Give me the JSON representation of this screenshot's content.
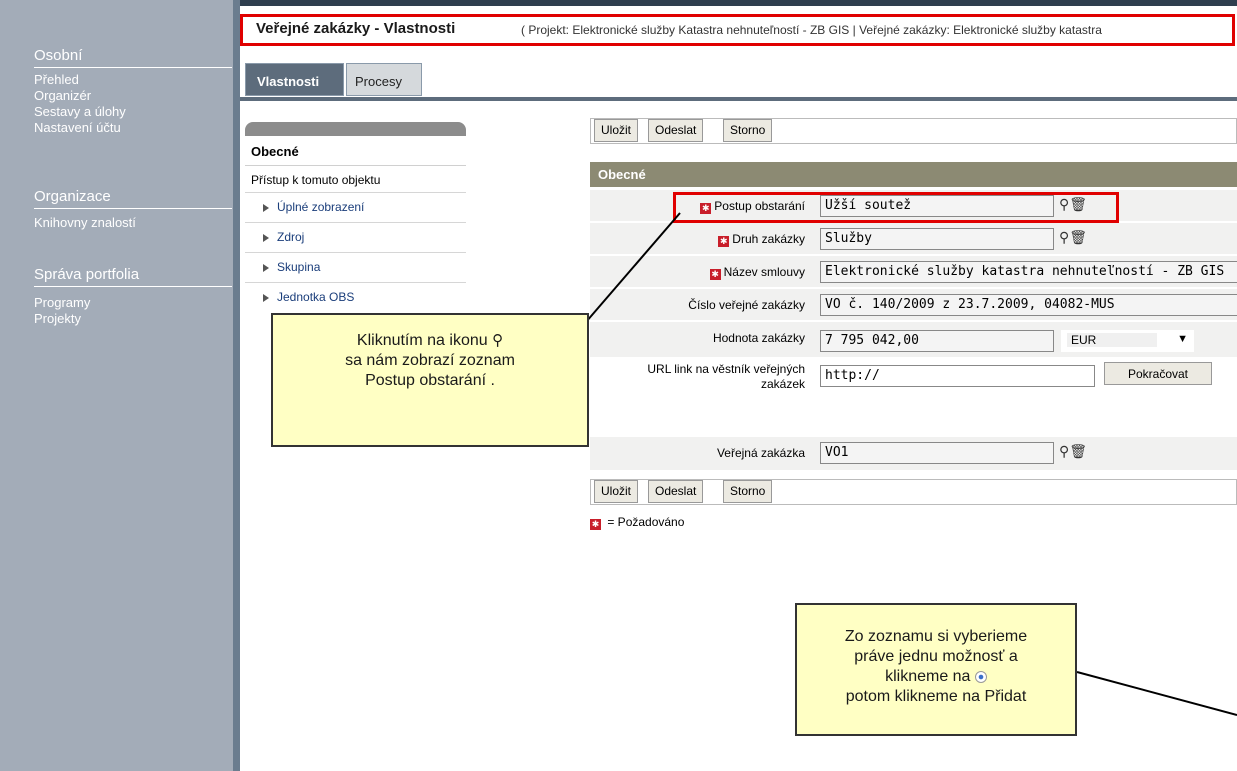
{
  "sidebar": {
    "osobni": {
      "title": "Osobní",
      "items": [
        "Přehled",
        "Organizér",
        "Sestavy a úlohy",
        "Nastavení účtu"
      ]
    },
    "organizace": {
      "title": "Organizace",
      "items": [
        "Knihovny znalostí"
      ]
    },
    "sprava": {
      "title": "Správa portfolia",
      "items": [
        "Programy",
        "Projekty"
      ]
    }
  },
  "header": {
    "title": "Veřejné zakázky - Vlastnosti",
    "subtitle": "( Projekt: Elektronické služby Katastra nehnuteľností - ZB GIS | Veřejné zakázky: Elektronické služby katastra"
  },
  "tabs": [
    "Vlastnosti",
    "Procesy"
  ],
  "nav": {
    "section": "Obecné",
    "access": "Přístup k tomuto objektu",
    "items": [
      "Úplné zobrazení",
      "Zdroj",
      "Skupina",
      "Jednotka OBS"
    ]
  },
  "buttons": {
    "save": "Uložit",
    "send": "Odeslat",
    "cancel": "Storno",
    "continue": "Pokračovat"
  },
  "form": {
    "title": "Obecné",
    "fields": {
      "postup": {
        "label": "Postup obstarání",
        "value": "Užší soutež"
      },
      "druh": {
        "label": "Druh zakázky",
        "value": "Služby"
      },
      "nazev": {
        "label": "Název smlouvy",
        "value": "Elektronické služby katastra nehnuteľností - ZB GIS"
      },
      "cislo": {
        "label": "Číslo veřejné zakázky",
        "value": "VO č. 140/2009 z 23.7.2009, 04082-MUS"
      },
      "hodnota": {
        "label": "Hodnota zakázky",
        "value": "7 795 042,00",
        "currency": "EUR"
      },
      "url": {
        "label": "URL link na věstník veřejných zakázek",
        "value": "http://"
      },
      "vz": {
        "label": "Veřejná zakázka",
        "value": "VO1"
      }
    },
    "required_legend": "= Požadováno"
  },
  "callouts": {
    "first": {
      "line1": "Kliknutím na ikonu",
      "line2": "sa nám zobrazí zoznam",
      "line3": "Postup obstarání ."
    },
    "second": {
      "line1": "Zo zoznamu si vyberieme",
      "line2": "práve jednu možnosť a",
      "line3": "klikneme na",
      "line4": "potom klikneme na Přidat"
    }
  },
  "icons": {
    "lookup": "binoculars-icon",
    "clear": "trash-icon",
    "required": "required-star-icon"
  },
  "colors": {
    "sidebar": "#a3acb8",
    "highlight": "#e00000",
    "form_header": "#8c8a73",
    "callout": "#ffffc4"
  }
}
